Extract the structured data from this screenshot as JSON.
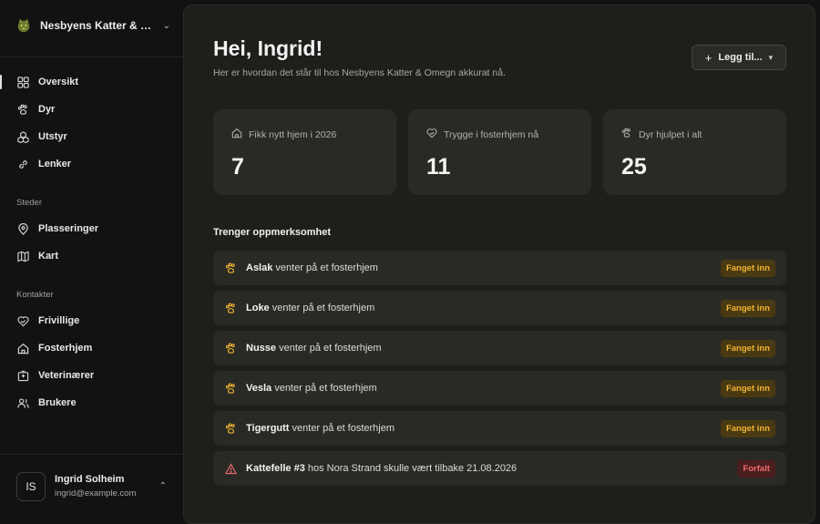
{
  "org": {
    "name": "Nesbyens Katter & O..."
  },
  "nav": {
    "main": [
      {
        "label": "Oversikt",
        "icon": "dashboard-icon",
        "active": true
      },
      {
        "label": "Dyr",
        "icon": "paw-icon"
      },
      {
        "label": "Utstyr",
        "icon": "boxes-icon"
      },
      {
        "label": "Lenker",
        "icon": "link-icon"
      }
    ],
    "section_places": "Steder",
    "places": [
      {
        "label": "Plasseringer",
        "icon": "map-pin-icon"
      },
      {
        "label": "Kart",
        "icon": "map-icon"
      }
    ],
    "section_contacts": "Kontakter",
    "contacts": [
      {
        "label": "Frivillige",
        "icon": "heart-handshake-icon"
      },
      {
        "label": "Fosterhjem",
        "icon": "home-icon"
      },
      {
        "label": "Veterinærer",
        "icon": "hospital-icon"
      },
      {
        "label": "Brukere",
        "icon": "users-icon"
      }
    ]
  },
  "user": {
    "initials": "IS",
    "name": "Ingrid Solheim",
    "email": "ingrid@example.com"
  },
  "header": {
    "greeting": "Hei, Ingrid!",
    "subtitle": "Her er hvordan det står til hos Nesbyens Katter & Omegn akkurat nå.",
    "add_label": "Legg til..."
  },
  "stats": [
    {
      "label": "Fikk nytt hjem i 2026",
      "value": "7",
      "icon": "home-icon"
    },
    {
      "label": "Trygge i fosterhjem nå",
      "value": "11",
      "icon": "heart-handshake-icon"
    },
    {
      "label": "Dyr hjulpet i alt",
      "value": "25",
      "icon": "paw-icon"
    }
  ],
  "attention": {
    "title": "Trenger oppmerksomhet",
    "items": [
      {
        "name": "Aslak",
        "text": " venter på et fosterhjem",
        "badge": "Fanget inn",
        "kind": "warn"
      },
      {
        "name": "Loke",
        "text": " venter på et fosterhjem",
        "badge": "Fanget inn",
        "kind": "warn"
      },
      {
        "name": "Nusse",
        "text": " venter på et fosterhjem",
        "badge": "Fanget inn",
        "kind": "warn"
      },
      {
        "name": "Vesla",
        "text": " venter på et fosterhjem",
        "badge": "Fanget inn",
        "kind": "warn"
      },
      {
        "name": "Tigergutt",
        "text": " venter på et fosterhjem",
        "badge": "Fanget inn",
        "kind": "warn"
      },
      {
        "name": "Kattefelle #3",
        "text": " hos Nora Strand skulle vært tilbake 21.08.2026",
        "badge": "Forfalt",
        "kind": "danger"
      }
    ]
  },
  "colors": {
    "warn": "#f0b432",
    "danger": "#ef6b6b",
    "surface": "#2a2a25"
  }
}
